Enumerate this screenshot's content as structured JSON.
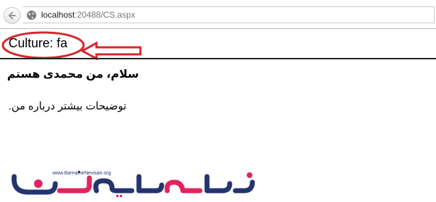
{
  "browser": {
    "url_host": "localhost",
    "url_rest": ":20488/CS.aspx"
  },
  "page": {
    "culture_heading": "Culture: fa",
    "greeting": "سلام، من محمدی هستم",
    "description": "توضیحات بیشتر درباره من."
  },
  "logo": {
    "tagline": "www.BarnameNevisan.org",
    "wordmark": "برنامه نویسان"
  },
  "colors": {
    "annotation_red": "#d8262c",
    "logo_pink": "#e0245e",
    "logo_navy": "#24356d"
  }
}
